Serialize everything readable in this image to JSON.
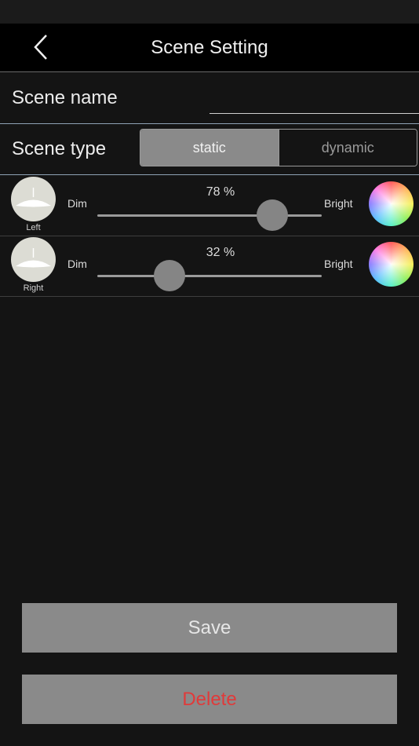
{
  "header": {
    "title": "Scene Setting",
    "back_icon": "chevron-left-icon"
  },
  "scene_name": {
    "label": "Scene name",
    "value": "",
    "placeholder": ""
  },
  "scene_type": {
    "label": "Scene type",
    "options": [
      "static",
      "dynamic"
    ],
    "selected": "static"
  },
  "lights": [
    {
      "name": "Left",
      "dim_label": "Dim",
      "bright_label": "Bright",
      "brightness_percent": 78,
      "percent_text": "78 %"
    },
    {
      "name": "Right",
      "dim_label": "Dim",
      "bright_label": "Bright",
      "brightness_percent": 32,
      "percent_text": "32 %"
    }
  ],
  "actions": {
    "save_label": "Save",
    "delete_label": "Delete"
  },
  "colors": {
    "background": "#141414",
    "nav_background": "#000000",
    "button_gray": "#8a8a8a",
    "delete_red": "#e03a3a"
  }
}
